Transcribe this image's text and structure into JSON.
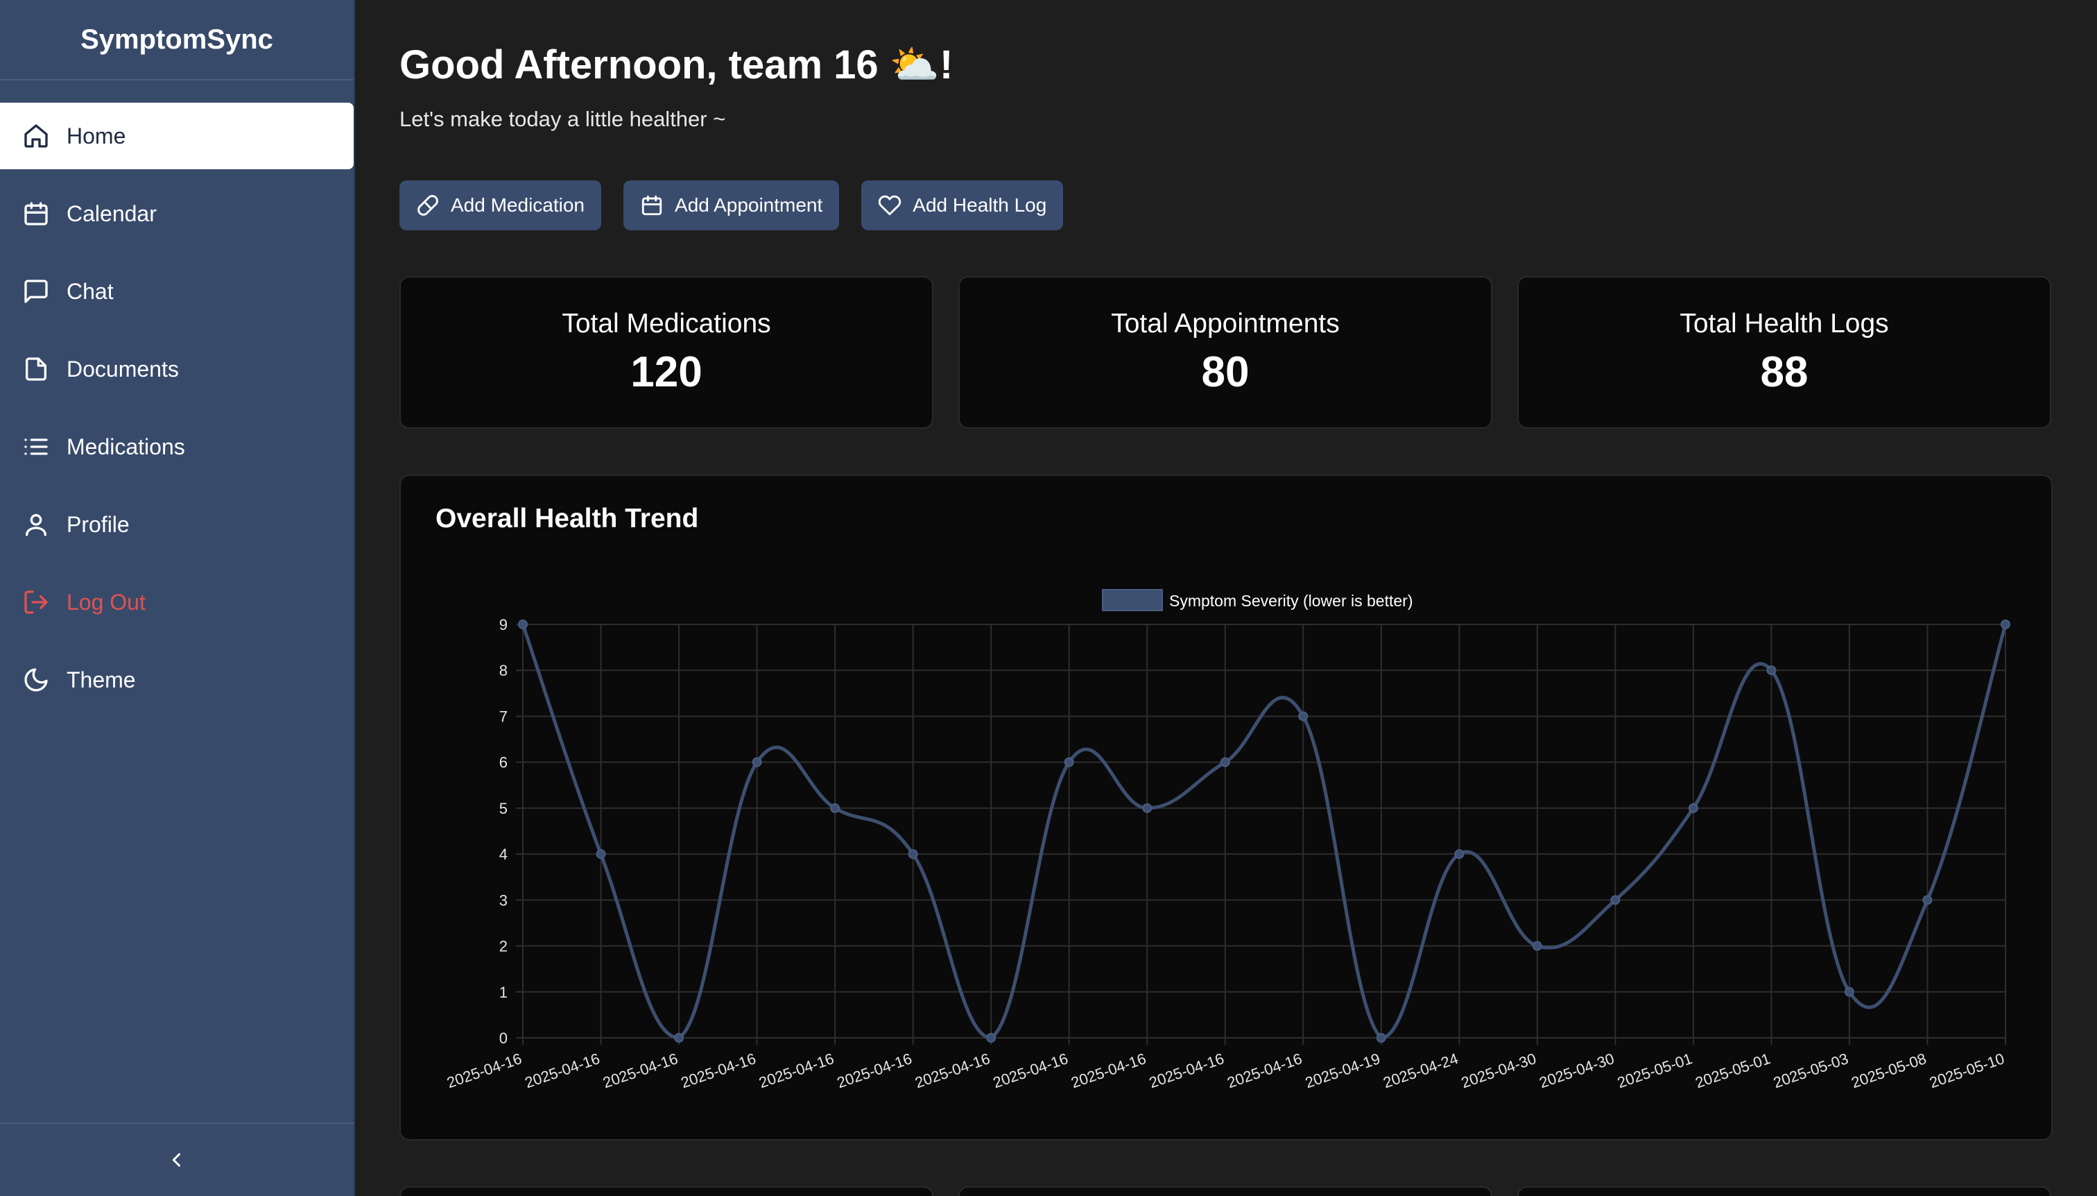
{
  "app": {
    "name": "SymptomSync"
  },
  "sidebar": {
    "items": [
      {
        "label": "Home",
        "icon": "home-icon"
      },
      {
        "label": "Calendar",
        "icon": "calendar-icon"
      },
      {
        "label": "Chat",
        "icon": "chat-icon"
      },
      {
        "label": "Documents",
        "icon": "document-icon"
      },
      {
        "label": "Medications",
        "icon": "list-icon"
      },
      {
        "label": "Profile",
        "icon": "user-icon"
      },
      {
        "label": "Log Out",
        "icon": "logout-icon"
      },
      {
        "label": "Theme",
        "icon": "moon-icon"
      }
    ],
    "active": "Home",
    "collapse_icon": "chevron-left-icon"
  },
  "header": {
    "greeting": "Good Afternoon, team 16 ⛅!",
    "subtitle": "Let's make today a little healther ~"
  },
  "actions": {
    "add_medication": "Add Medication",
    "add_appointment": "Add Appointment",
    "add_health_log": "Add Health Log"
  },
  "stats": {
    "medications": {
      "label": "Total Medications",
      "value": "120"
    },
    "appointments": {
      "label": "Total Appointments",
      "value": "80"
    },
    "health_logs": {
      "label": "Total Health Logs",
      "value": "88"
    }
  },
  "colors": {
    "sidebar": "#384a6a",
    "accent": "#3a4c6d",
    "danger": "#e05252",
    "line": "#3d4f70"
  },
  "chart_data": {
    "type": "line",
    "title": "Overall Health Trend",
    "legend_position": "top-center",
    "grid": true,
    "ylim": [
      0,
      9
    ],
    "y_ticks": [
      0,
      1,
      2,
      3,
      4,
      5,
      6,
      7,
      8,
      9
    ],
    "x": [
      "2025-04-16",
      "2025-04-16",
      "2025-04-16",
      "2025-04-16",
      "2025-04-16",
      "2025-04-16",
      "2025-04-16",
      "2025-04-16",
      "2025-04-16",
      "2025-04-16",
      "2025-04-16",
      "2025-04-19",
      "2025-04-24",
      "2025-04-30",
      "2025-04-30",
      "2025-05-01",
      "2025-05-01",
      "2025-05-03",
      "2025-05-08",
      "2025-05-10"
    ],
    "series": [
      {
        "name": "Symptom Severity (lower is better)",
        "values": [
          9,
          4,
          0,
          6,
          5,
          4,
          0,
          6,
          5,
          6,
          7,
          0,
          4,
          2,
          3,
          5,
          8,
          1,
          3,
          9
        ]
      }
    ]
  }
}
